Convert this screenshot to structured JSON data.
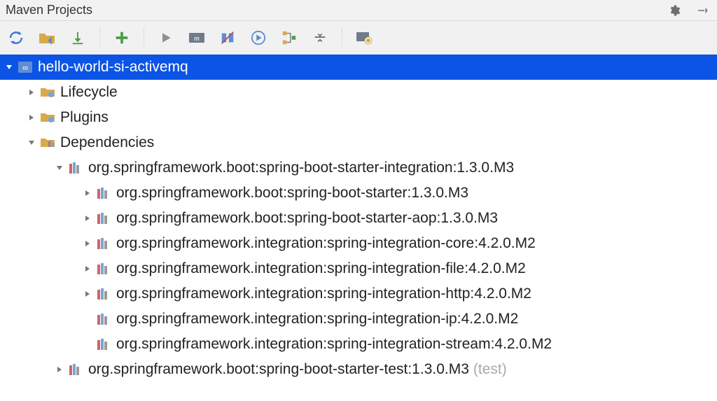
{
  "title": "Maven Projects",
  "toolbar": {
    "refresh": "Refresh",
    "generate_sources": "Generate Sources",
    "download": "Download",
    "add": "Add",
    "run": "Run",
    "run_maven": "Run Maven Build",
    "toggle_offline": "Toggle Offline",
    "execute": "Execute Goal",
    "show_deps": "Show Dependencies",
    "collapse": "Collapse All",
    "settings": "Maven Settings"
  },
  "gear_label": "Settings",
  "hide_label": "Hide",
  "tree": {
    "root": {
      "label": "hello-world-si-activemq",
      "expanded": true,
      "children": [
        {
          "key": "lifecycle",
          "label": "Lifecycle",
          "expanded": false,
          "icon": "folder-gear"
        },
        {
          "key": "plugins",
          "label": "Plugins",
          "expanded": false,
          "icon": "folder-gear"
        },
        {
          "key": "deps",
          "label": "Dependencies",
          "expanded": true,
          "icon": "folder-bars",
          "children": [
            {
              "key": "d0",
              "label": "org.springframework.boot:spring-boot-starter-integration:1.3.0.M3",
              "expanded": true,
              "children": [
                {
                  "key": "d0c0",
                  "label": "org.springframework.boot:spring-boot-starter:1.3.0.M3",
                  "expanded": false
                },
                {
                  "key": "d0c1",
                  "label": "org.springframework.boot:spring-boot-starter-aop:1.3.0.M3",
                  "expanded": false
                },
                {
                  "key": "d0c2",
                  "label": "org.springframework.integration:spring-integration-core:4.2.0.M2",
                  "expanded": false
                },
                {
                  "key": "d0c3",
                  "label": "org.springframework.integration:spring-integration-file:4.2.0.M2",
                  "expanded": false
                },
                {
                  "key": "d0c4",
                  "label": "org.springframework.integration:spring-integration-http:4.2.0.M2",
                  "expanded": false
                },
                {
                  "key": "d0c5",
                  "label": "org.springframework.integration:spring-integration-ip:4.2.0.M2",
                  "leaf": true
                },
                {
                  "key": "d0c6",
                  "label": "org.springframework.integration:spring-integration-stream:4.2.0.M2",
                  "leaf": true
                }
              ]
            },
            {
              "key": "d1",
              "label": "org.springframework.boot:spring-boot-starter-test:1.3.0.M3",
              "scope": "(test)",
              "expanded": false
            }
          ]
        }
      ]
    }
  }
}
